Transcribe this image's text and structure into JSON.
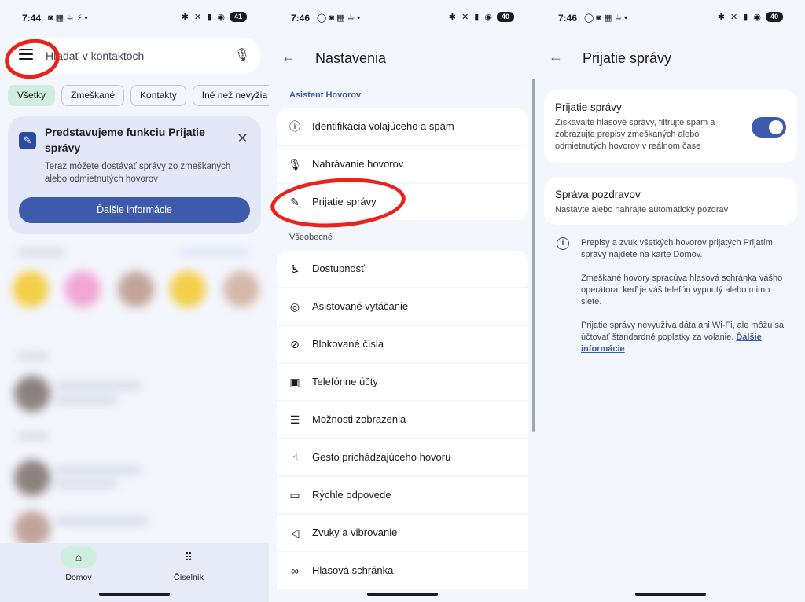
{
  "panel1": {
    "status": {
      "time": "7:44",
      "battery": "41"
    },
    "search": {
      "placeholder": "Hľadať v kontaktoch"
    },
    "chips": [
      "Všetky",
      "Zmeškané",
      "Kontakty",
      "Iné než nevyžia"
    ],
    "promo": {
      "title": "Predstavujeme funkciu Prijatie správy",
      "description": "Teraz môžete dostávať správy zo zmeškaných alebo odmietnutých hovorov",
      "button": "Ďalšie informácie"
    },
    "nav": [
      {
        "label": "Domov",
        "icon": "home-icon"
      },
      {
        "label": "Číselník",
        "icon": "dialpad-icon"
      }
    ]
  },
  "panel2": {
    "status": {
      "time": "7:46",
      "battery": "40"
    },
    "title": "Nastavenia",
    "sections": [
      {
        "label": "Asistent Hovorov",
        "items": [
          "Identifikácia volajúceho a spam",
          "Nahrávanie hovorov",
          "Prijatie správy"
        ]
      },
      {
        "label": "Všeobecné",
        "items": [
          "Dostupnosť",
          "Asistované vytáčanie",
          "Blokované čísla",
          "Telefónne účty",
          "Možnosti zobrazenia",
          "Gesto prichádzajúceho hovoru",
          "Rýchle odpovede",
          "Zvuky a vibrovanie",
          "Hlasová schránka"
        ]
      }
    ]
  },
  "panel3": {
    "status": {
      "time": "7:46",
      "battery": "40"
    },
    "title": "Prijatie správy",
    "toggle_card": {
      "title": "Prijatie správy",
      "description": "Získavajte hlasové správy, filtrujte spam a zobrazujte prepisy zmeškaných alebo odmietnutých hovorov v reálnom čase",
      "enabled": true
    },
    "greeting_card": {
      "title": "Správa pozdravov",
      "description": "Nastavte alebo nahrajte automatický pozdrav"
    },
    "info": {
      "p1": "Prepisy a zvuk všetkých hovorov prijatých Prijatím správy nájdete na karte Domov.",
      "p2": "Zmeškané hovory spracúva hlasová schránka vášho operátora, keď je váš telefón vypnutý alebo mimo siete.",
      "p3": "Prijatie správy nevyužíva dáta ani Wi-Fi, ale môžu sa účtovať štandardné poplatky za volanie.",
      "link": "Ďalšie informácie"
    }
  },
  "colors": {
    "accent": "#3d5aab",
    "annotation": "#e8231b",
    "chip_active": "#cfeedd"
  }
}
